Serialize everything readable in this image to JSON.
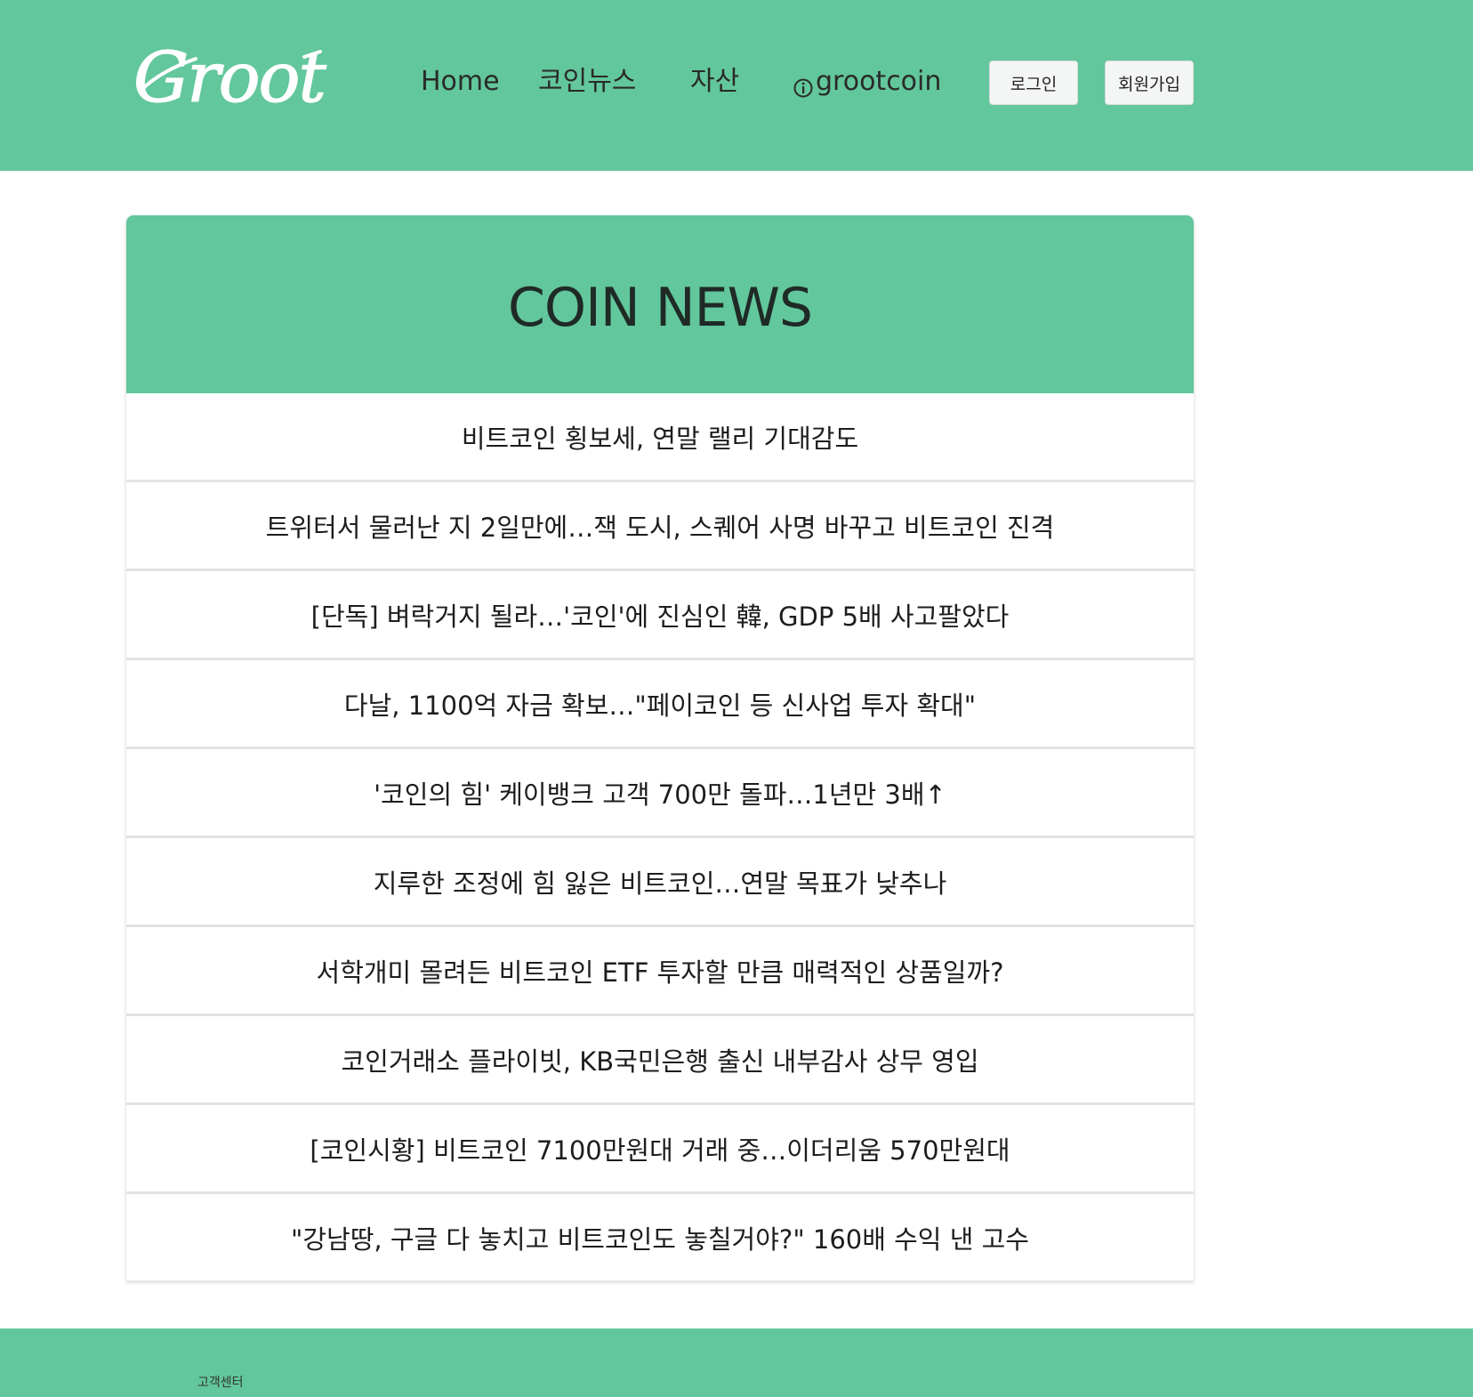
{
  "header": {
    "logo_text": "Groot",
    "nav": {
      "home": "Home",
      "coin_news": "코인뉴스",
      "assets": "자산",
      "instagram": "grootcoin"
    },
    "buttons": {
      "login": "로그인",
      "signup": "회원가입"
    },
    "icons": {
      "instagram": "instagram-icon"
    }
  },
  "news": {
    "title": "COIN NEWS",
    "items": [
      "비트코인 횡보세, 연말 랠리 기대감도",
      "트위터서 물러난 지 2일만에…잭 도시, 스퀘어 사명 바꾸고 비트코인 진격",
      "[단독] 벼락거지 될라…'코인'에 진심인 韓, GDP 5배 사고팔았다",
      "다날, 1100억 자금 확보…\"페이코인 등 신사업 투자 확대\"",
      "'코인의 힘' 케이뱅크 고객 700만 돌파…1년만 3배↑",
      "지루한 조정에 힘 잃은 비트코인…연말 목표가 낮추나",
      "서학개미 몰려든 비트코인 ETF 투자할 만큼 매력적인 상품일까?",
      "코인거래소 플라이빗, KB국민은행 출신 내부감사 상무 영입",
      "[코인시황] 비트코인 7100만원대 거래 중…이더리움 570만원대",
      "\"강남땅, 구글 다 놓치고 비트코인도 놓칠거야?\" 160배 수익 낸 고수"
    ]
  },
  "footer": {
    "customer_center": "고객센터"
  },
  "colors": {
    "brand_green": "#62c79c",
    "text_dark": "#1d1d1d",
    "divider": "#e3e3e3"
  }
}
